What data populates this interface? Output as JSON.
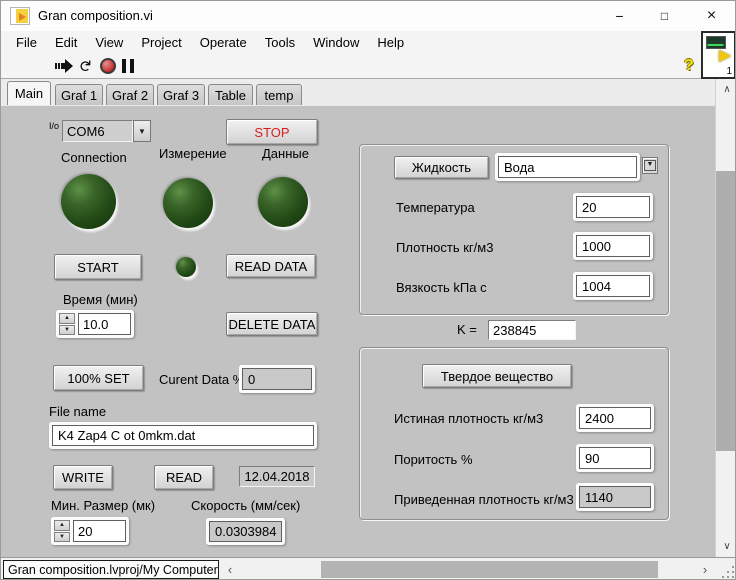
{
  "window": {
    "title": "Gran composition.vi",
    "minimize": "−",
    "maximize": "□",
    "close": "×"
  },
  "menu": {
    "items": [
      "File",
      "Edit",
      "View",
      "Project",
      "Operate",
      "Tools",
      "Window",
      "Help"
    ]
  },
  "toolbar": {
    "help_glyph": "?",
    "continuous_glyph": "↻",
    "vi_badge": "1"
  },
  "tabs": {
    "items": [
      "Main",
      "Graf 1",
      "Graf 2",
      "Graf 3",
      "Table",
      "temp"
    ],
    "active": "Main"
  },
  "glyphs": {
    "dropdown": "▼",
    "spin_up": "▲",
    "spin_down": "▼",
    "scroll_up": "∧",
    "scroll_down": "∨",
    "scroll_left": "‹",
    "scroll_right": "›"
  },
  "left": {
    "com_port": {
      "io_glyph": "I/o",
      "value": "COM6"
    },
    "stop_button": "STOP",
    "connection_label": "Connection",
    "measure_label": "Измерение",
    "data_label": "Данные",
    "start_button": "START",
    "read_data_button": "READ DATA",
    "delete_data_button": "DELETE DATA",
    "time": {
      "label": "Время (мин)",
      "value": "10.0"
    },
    "set100_button": "100% SET",
    "current_data": {
      "label": "Curent Data %",
      "value": "0"
    },
    "file": {
      "label": "File name",
      "value": "K4 Zap4 C ot 0mkm.dat"
    },
    "write_button": "WRITE",
    "read_button": "READ",
    "date_value": "12.04.2018",
    "min_size": {
      "label": "Мин. Размер (мк)",
      "value": "20"
    },
    "speed": {
      "label": "Скорость (мм/сек)",
      "value": "0.0303984"
    }
  },
  "right": {
    "liquid": {
      "button": "Жидкость",
      "selected": "Вода",
      "temperature": {
        "label": "Температура",
        "value": "20"
      },
      "density": {
        "label": "Плотность  кг/м3",
        "value": "1000"
      },
      "viscosity": {
        "label": "Вязкость kПа с",
        "value": "1004"
      }
    },
    "k": {
      "label": "K =",
      "value": "238845"
    },
    "solid": {
      "button": "Твердое вещество",
      "true_density": {
        "label": "Истиная плотность кг/м3",
        "value": "2400"
      },
      "porosity": {
        "label": "Поритость  %",
        "value": "90"
      },
      "reduced_density": {
        "label": "Приведенная плотность  кг/м3",
        "value": "1140"
      }
    }
  },
  "status": {
    "project": "Gran composition.lvproj/My Computer"
  },
  "colors": {
    "stop_text": "#d81e1e",
    "led_green": "#2d5016",
    "panel_gray": "#c2c2c2"
  }
}
